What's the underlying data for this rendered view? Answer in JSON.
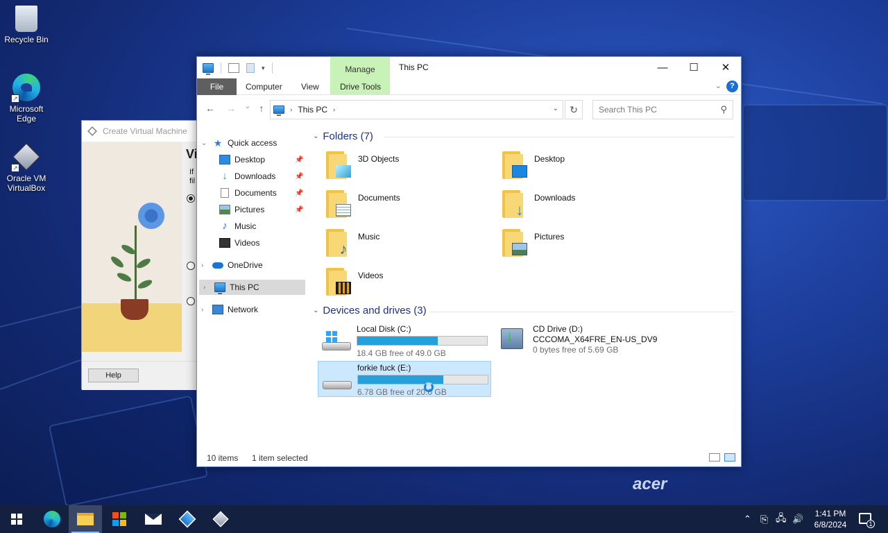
{
  "desktop": {
    "icons": [
      {
        "label": "Recycle Bin",
        "icon": "recycle-bin-icon"
      },
      {
        "label": "Microsoft Edge",
        "icon": "edge-icon"
      },
      {
        "label": "Oracle VM VirtualBox",
        "icon": "virtualbox-icon"
      }
    ],
    "wallpaper_brand": "acer"
  },
  "vbox_dialog": {
    "title": "Create Virtual Machine",
    "heading_fragment": "Vi",
    "text_fragment_1": "If",
    "text_fragment_2": "fil",
    "help_label": "Help"
  },
  "explorer": {
    "title": "This PC",
    "context_tab": "Manage",
    "tabs": [
      "File",
      "Computer",
      "View",
      "Drive Tools"
    ],
    "window_controls": {
      "minimize": "—",
      "maximize": "☐",
      "close": "✕"
    },
    "address": {
      "crumb": "This PC"
    },
    "search": {
      "placeholder": "Search This PC"
    },
    "nav": {
      "quick_access": "Quick access",
      "items": [
        {
          "label": "Desktop",
          "pinned": true
        },
        {
          "label": "Downloads",
          "pinned": true
        },
        {
          "label": "Documents",
          "pinned": true
        },
        {
          "label": "Pictures",
          "pinned": true
        },
        {
          "label": "Music",
          "pinned": false
        },
        {
          "label": "Videos",
          "pinned": false
        }
      ],
      "onedrive": "OneDrive",
      "this_pc": "This PC",
      "network": "Network"
    },
    "folders_header": "Folders (7)",
    "folders": [
      "3D Objects",
      "Desktop",
      "Documents",
      "Downloads",
      "Music",
      "Pictures",
      "Videos"
    ],
    "drives_header": "Devices and drives (3)",
    "drives": [
      {
        "name": "Local Disk (C:)",
        "free": "18.4 GB free of 49.0 GB",
        "used_fraction": 0.62
      },
      {
        "name": "CD Drive (D:)",
        "label": "CCCOMA_X64FRE_EN-US_DV9",
        "free": "0 bytes free of 5.69 GB"
      },
      {
        "name": "forkie fuck (E:)",
        "free": "6.78 GB free of 20.0 GB",
        "used_fraction": 0.66
      }
    ],
    "status": {
      "items": "10 items",
      "selected": "1 item selected"
    }
  },
  "taskbar": {
    "time": "1:41 PM",
    "date": "6/8/2024",
    "notification_count": "1",
    "tray_chevron": "⌃",
    "volume_icon": "🔊"
  }
}
